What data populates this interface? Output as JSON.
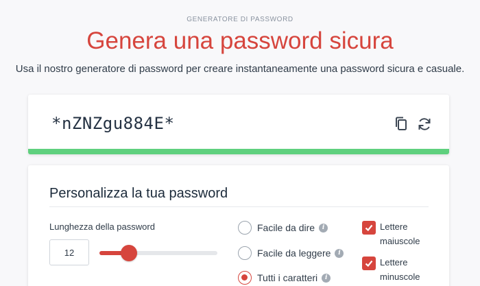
{
  "header": {
    "eyebrow": "GENERATORE DI PASSWORD",
    "title": "Genera una password sicura",
    "subtitle": "Usa il nostro generatore di password per creare instantaneamente una password sicura e casuale."
  },
  "password": {
    "value": "*nZNZgu884E*",
    "copy_icon": "copy-icon",
    "refresh_icon": "refresh-icon",
    "strength_color": "#5fd07e"
  },
  "customize": {
    "title": "Personalizza la tua password",
    "length_label": "Lunghezza della password",
    "length_value": "12",
    "slider_fraction": 0.25,
    "modes": [
      {
        "label": "Facile da dire",
        "selected": false
      },
      {
        "label": "Facile da leggere",
        "selected": false
      },
      {
        "label": "Tutti i caratteri",
        "selected": true
      }
    ],
    "options": [
      {
        "label": "Lettere maiuscole",
        "checked": true
      },
      {
        "label": "Lettere minuscole",
        "checked": true
      }
    ]
  },
  "colors": {
    "accent": "#d6453d",
    "strength": "#5fd07e"
  }
}
